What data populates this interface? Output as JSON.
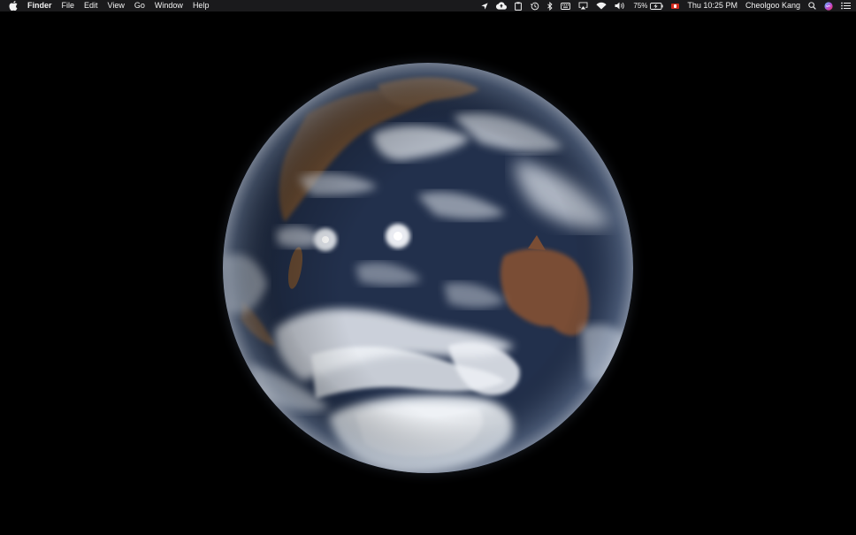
{
  "menubar": {
    "app_name": "Finder",
    "menus": [
      "File",
      "Edit",
      "View",
      "Go",
      "Window",
      "Help"
    ],
    "battery_percent": "75%",
    "clock": "Thu 10:25 PM",
    "user_name": "Cheolgoo Kang"
  },
  "icons": {
    "apple": "apple-icon",
    "location": "location-arrow-icon",
    "cloud": "cloud-upload-icon",
    "clipboard": "clipboard-icon",
    "time_machine": "time-machine-icon",
    "bluetooth": "bluetooth-icon",
    "keyboard": "keyboard-icon",
    "airplay": "airplay-icon",
    "wifi": "wifi-icon",
    "volume": "volume-icon",
    "battery": "battery-charging-icon",
    "flag": "canada-flag-icon",
    "spotlight": "spotlight-search-icon",
    "siri": "siri-icon",
    "notification": "notification-center-icon"
  },
  "colors": {
    "menubar_bg": "#1c1c1e",
    "menubar_text": "#f2f2f2",
    "desktop_bg": "#000000",
    "ocean": "#24324f",
    "cloud": "#e8ecf2",
    "land": "#7a5a3e"
  }
}
